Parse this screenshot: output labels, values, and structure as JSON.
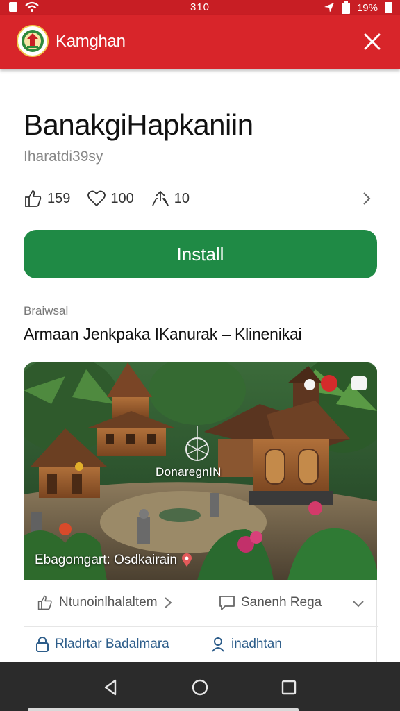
{
  "status_bar": {
    "time": "310",
    "battery": "19%",
    "icons": [
      "notification-icon",
      "wifi-icon",
      "location-icon",
      "signal-icon",
      "battery-icon"
    ]
  },
  "app_bar": {
    "title": "Kamghan",
    "logo_icon": "emblem-icon",
    "close_icon": "close-icon",
    "color": "#d8252a"
  },
  "app": {
    "title": "BanakgiHapkaniin",
    "subtitle": "Iharatdi39sy"
  },
  "stats": {
    "likes": "159",
    "favorites": "100",
    "shares": "10",
    "icons": [
      "thumbs-up-icon",
      "heart-icon",
      "share-icon",
      "chevron-right-icon"
    ]
  },
  "install": {
    "label": "Install",
    "color": "#1f8a45"
  },
  "section": {
    "label": "Braiwsal",
    "title": "Armaan Jenkpaka IKanurak – Klinenikai"
  },
  "hero": {
    "title": "DonaregnIN",
    "caption": "Ebagomgart:  Osdkairain",
    "caption_icon": "location-pin-icon"
  },
  "info": {
    "cell_a": "Ntunoinlhalaltem",
    "cell_b": "Sanenh Rega",
    "cell_c": "Rladrtar Badalmara",
    "cell_d": "inadhtan"
  },
  "nav": {
    "icons": [
      "back-icon",
      "home-icon",
      "recents-icon"
    ]
  }
}
